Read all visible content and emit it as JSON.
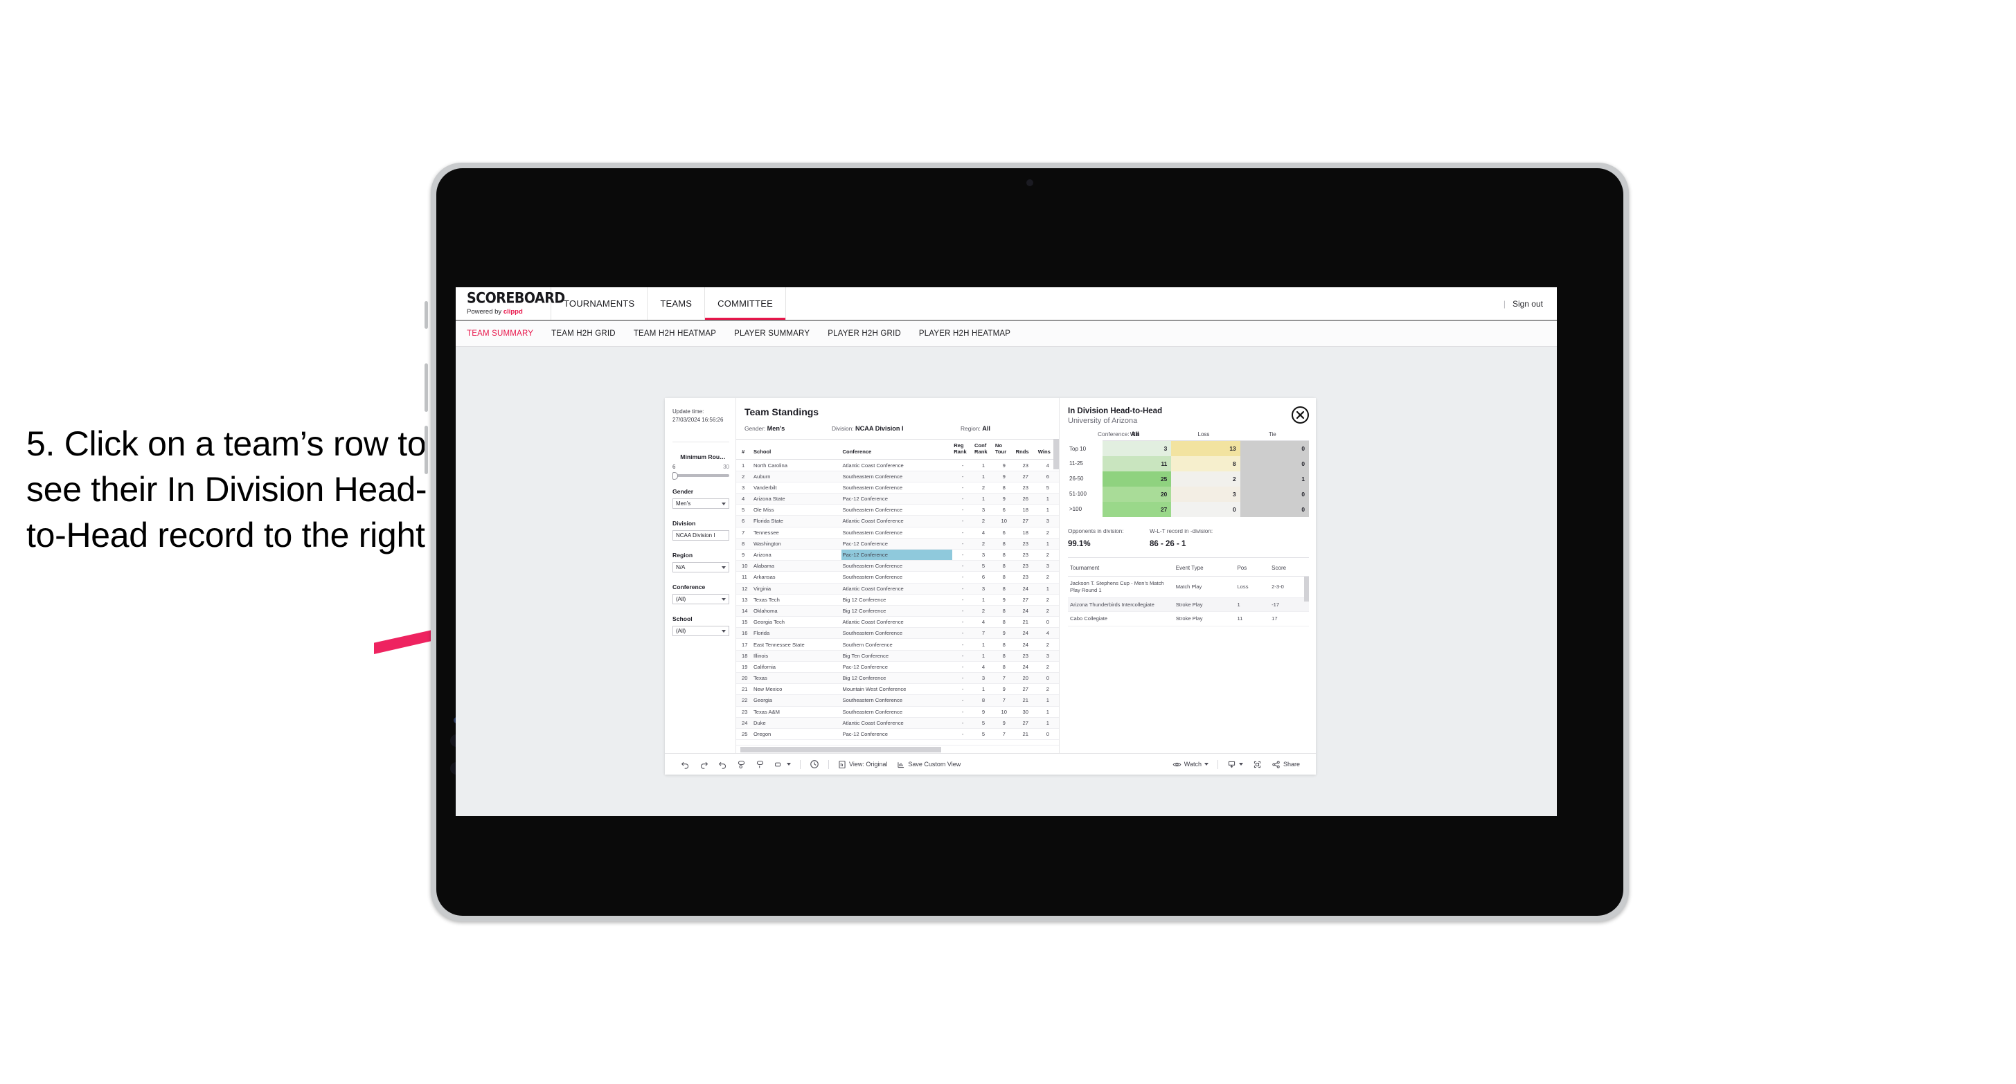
{
  "annotation": {
    "text": "5. Click on a team’s row to see their In Division Head-to-Head record to the right",
    "arrow_color": "#ee2360"
  },
  "topnav": {
    "brand_title": "SCOREBOARD",
    "brand_sub_prefix": "Powered by ",
    "brand_sub_brand": "clippd",
    "items": [
      {
        "label": "TOURNAMENTS",
        "active": false
      },
      {
        "label": "TEAMS",
        "active": false
      },
      {
        "label": "COMMITTEE",
        "active": true
      }
    ],
    "divider": "|",
    "sign_out": "Sign out"
  },
  "subnav": {
    "items": [
      {
        "label": "TEAM SUMMARY",
        "active": true
      },
      {
        "label": "TEAM H2H GRID",
        "active": false
      },
      {
        "label": "TEAM H2H HEATMAP",
        "active": false
      },
      {
        "label": "PLAYER SUMMARY",
        "active": false
      },
      {
        "label": "PLAYER H2H GRID",
        "active": false
      },
      {
        "label": "PLAYER H2H HEATMAP",
        "active": false
      }
    ]
  },
  "filters": {
    "update_label": "Update time:",
    "update_time": "27/03/2024 16:56:26",
    "slider": {
      "title": "Minimum Rou…",
      "min": "6",
      "max": "30"
    },
    "selects": [
      {
        "title": "Gender",
        "value": "Men’s"
      },
      {
        "title": "Division",
        "value": "NCAA Division I"
      },
      {
        "title": "Region",
        "value": "N/A"
      },
      {
        "title": "Conference",
        "value": "(All)"
      },
      {
        "title": "School",
        "value": "(All)"
      }
    ]
  },
  "standings": {
    "title": "Team Standings",
    "meta": [
      {
        "label": "Gender: ",
        "value": "Men’s"
      },
      {
        "label": "Division: ",
        "value": "NCAA Division I"
      },
      {
        "label": "Region: ",
        "value": "All"
      },
      {
        "label": "Conference: ",
        "value": "All"
      }
    ],
    "columns": [
      "#",
      "School",
      "Conference",
      "Reg Rank",
      "Conf Rank",
      "No Tour",
      "Rnds",
      "Wins"
    ],
    "rows": [
      {
        "n": "1",
        "school": "North Carolina",
        "conf": "Atlantic Coast Conference",
        "reg": "-",
        "crank": "1",
        "notour": "9",
        "rnds": "23",
        "wins": "4"
      },
      {
        "n": "2",
        "school": "Auburn",
        "conf": "Southeastern Conference",
        "reg": "-",
        "crank": "1",
        "notour": "9",
        "rnds": "27",
        "wins": "6"
      },
      {
        "n": "3",
        "school": "Vanderbilt",
        "conf": "Southeastern Conference",
        "reg": "-",
        "crank": "2",
        "notour": "8",
        "rnds": "23",
        "wins": "5"
      },
      {
        "n": "4",
        "school": "Arizona State",
        "conf": "Pac-12 Conference",
        "reg": "-",
        "crank": "1",
        "notour": "9",
        "rnds": "26",
        "wins": "1"
      },
      {
        "n": "5",
        "school": "Ole Miss",
        "conf": "Southeastern Conference",
        "reg": "-",
        "crank": "3",
        "notour": "6",
        "rnds": "18",
        "wins": "1"
      },
      {
        "n": "6",
        "school": "Florida State",
        "conf": "Atlantic Coast Conference",
        "reg": "-",
        "crank": "2",
        "notour": "10",
        "rnds": "27",
        "wins": "3"
      },
      {
        "n": "7",
        "school": "Tennessee",
        "conf": "Southeastern Conference",
        "reg": "-",
        "crank": "4",
        "notour": "6",
        "rnds": "18",
        "wins": "2"
      },
      {
        "n": "8",
        "school": "Washington",
        "conf": "Pac-12 Conference",
        "reg": "-",
        "crank": "2",
        "notour": "8",
        "rnds": "23",
        "wins": "1"
      },
      {
        "n": "9",
        "school": "Arizona",
        "conf": "Pac-12 Conference",
        "reg": "-",
        "crank": "3",
        "notour": "8",
        "rnds": "23",
        "wins": "2",
        "selected": true
      },
      {
        "n": "10",
        "school": "Alabama",
        "conf": "Southeastern Conference",
        "reg": "-",
        "crank": "5",
        "notour": "8",
        "rnds": "23",
        "wins": "3"
      },
      {
        "n": "11",
        "school": "Arkansas",
        "conf": "Southeastern Conference",
        "reg": "-",
        "crank": "6",
        "notour": "8",
        "rnds": "23",
        "wins": "2"
      },
      {
        "n": "12",
        "school": "Virginia",
        "conf": "Atlantic Coast Conference",
        "reg": "-",
        "crank": "3",
        "notour": "8",
        "rnds": "24",
        "wins": "1"
      },
      {
        "n": "13",
        "school": "Texas Tech",
        "conf": "Big 12 Conference",
        "reg": "-",
        "crank": "1",
        "notour": "9",
        "rnds": "27",
        "wins": "2"
      },
      {
        "n": "14",
        "school": "Oklahoma",
        "conf": "Big 12 Conference",
        "reg": "-",
        "crank": "2",
        "notour": "8",
        "rnds": "24",
        "wins": "2"
      },
      {
        "n": "15",
        "school": "Georgia Tech",
        "conf": "Atlantic Coast Conference",
        "reg": "-",
        "crank": "4",
        "notour": "8",
        "rnds": "21",
        "wins": "0"
      },
      {
        "n": "16",
        "school": "Florida",
        "conf": "Southeastern Conference",
        "reg": "-",
        "crank": "7",
        "notour": "9",
        "rnds": "24",
        "wins": "4"
      },
      {
        "n": "17",
        "school": "East Tennessee State",
        "conf": "Southern Conference",
        "reg": "-",
        "crank": "1",
        "notour": "8",
        "rnds": "24",
        "wins": "2"
      },
      {
        "n": "18",
        "school": "Illinois",
        "conf": "Big Ten Conference",
        "reg": "-",
        "crank": "1",
        "notour": "8",
        "rnds": "23",
        "wins": "3"
      },
      {
        "n": "19",
        "school": "California",
        "conf": "Pac-12 Conference",
        "reg": "-",
        "crank": "4",
        "notour": "8",
        "rnds": "24",
        "wins": "2"
      },
      {
        "n": "20",
        "school": "Texas",
        "conf": "Big 12 Conference",
        "reg": "-",
        "crank": "3",
        "notour": "7",
        "rnds": "20",
        "wins": "0"
      },
      {
        "n": "21",
        "school": "New Mexico",
        "conf": "Mountain West Conference",
        "reg": "-",
        "crank": "1",
        "notour": "9",
        "rnds": "27",
        "wins": "2"
      },
      {
        "n": "22",
        "school": "Georgia",
        "conf": "Southeastern Conference",
        "reg": "-",
        "crank": "8",
        "notour": "7",
        "rnds": "21",
        "wins": "1"
      },
      {
        "n": "23",
        "school": "Texas A&M",
        "conf": "Southeastern Conference",
        "reg": "-",
        "crank": "9",
        "notour": "10",
        "rnds": "30",
        "wins": "1"
      },
      {
        "n": "24",
        "school": "Duke",
        "conf": "Atlantic Coast Conference",
        "reg": "-",
        "crank": "5",
        "notour": "9",
        "rnds": "27",
        "wins": "1"
      },
      {
        "n": "25",
        "school": "Oregon",
        "conf": "Pac-12 Conference",
        "reg": "-",
        "crank": "5",
        "notour": "7",
        "rnds": "21",
        "wins": "0"
      }
    ]
  },
  "h2h": {
    "title": "In Division Head-to-Head",
    "subtitle": "University of Arizona",
    "close_icon": "close-icon",
    "columns": [
      "Win",
      "Loss",
      "Tie"
    ],
    "rows": [
      {
        "label": "Top 10",
        "win": "3",
        "loss": "13",
        "tie": "0",
        "win_color": "#e2efe0",
        "loss_color": "#f2e3a0"
      },
      {
        "label": "11-25",
        "win": "11",
        "loss": "8",
        "tie": "0",
        "win_color": "#c9e5bf",
        "loss_color": "#f6efcd"
      },
      {
        "label": "26-50",
        "win": "25",
        "loss": "2",
        "tie": "1",
        "win_color": "#8fd27f",
        "loss_color": "#f1f0ec"
      },
      {
        "label": "51-100",
        "win": "20",
        "loss": "3",
        "tie": "0",
        "win_color": "#a9dc98",
        "loss_color": "#f3eee4"
      },
      {
        "label": ">100",
        "win": "27",
        "loss": "0",
        "tie": "0",
        "win_color": "#9ad88a",
        "loss_color": "#f2f2f0"
      }
    ],
    "tie_color": "#cdcdcd",
    "summary": [
      {
        "label": "Opponents in division:",
        "value": "99.1%"
      },
      {
        "label": "W-L-T record in -division:",
        "value": "86 - 26 - 1"
      }
    ],
    "tournaments": {
      "columns": [
        "Tournament",
        "Event Type",
        "Pos",
        "Score"
      ],
      "rows": [
        {
          "name": "Jackson T. Stephens Cup - Men’s Match Play Round 1",
          "type": "Match Play",
          "pos": "Loss",
          "score": "2-3-0"
        },
        {
          "name": "Arizona Thunderbirds Intercollegiate",
          "type": "Stroke Play",
          "pos": "1",
          "score": "-17"
        },
        {
          "name": "Cabo Collegiate",
          "type": "Stroke Play",
          "pos": "11",
          "score": "17"
        }
      ]
    }
  },
  "toolbar": {
    "left_icons": [
      "undo-icon",
      "redo-icon",
      "revert-icon",
      "pause-refresh-icon",
      "refresh-icon",
      "rectangle-select-icon",
      "chevron-down-icon"
    ],
    "clock_icon": "history-icon",
    "view_icon": "view-icon",
    "view_label": "View: Original",
    "save_icon": "save-view-icon",
    "save_label": "Save Custom View",
    "watch_icon": "eye-icon",
    "watch_label": "Watch",
    "download_icon": "download-icon",
    "fullscreen_icon": "fullscreen-icon",
    "share_icon": "share-icon",
    "share_label": "Share"
  }
}
